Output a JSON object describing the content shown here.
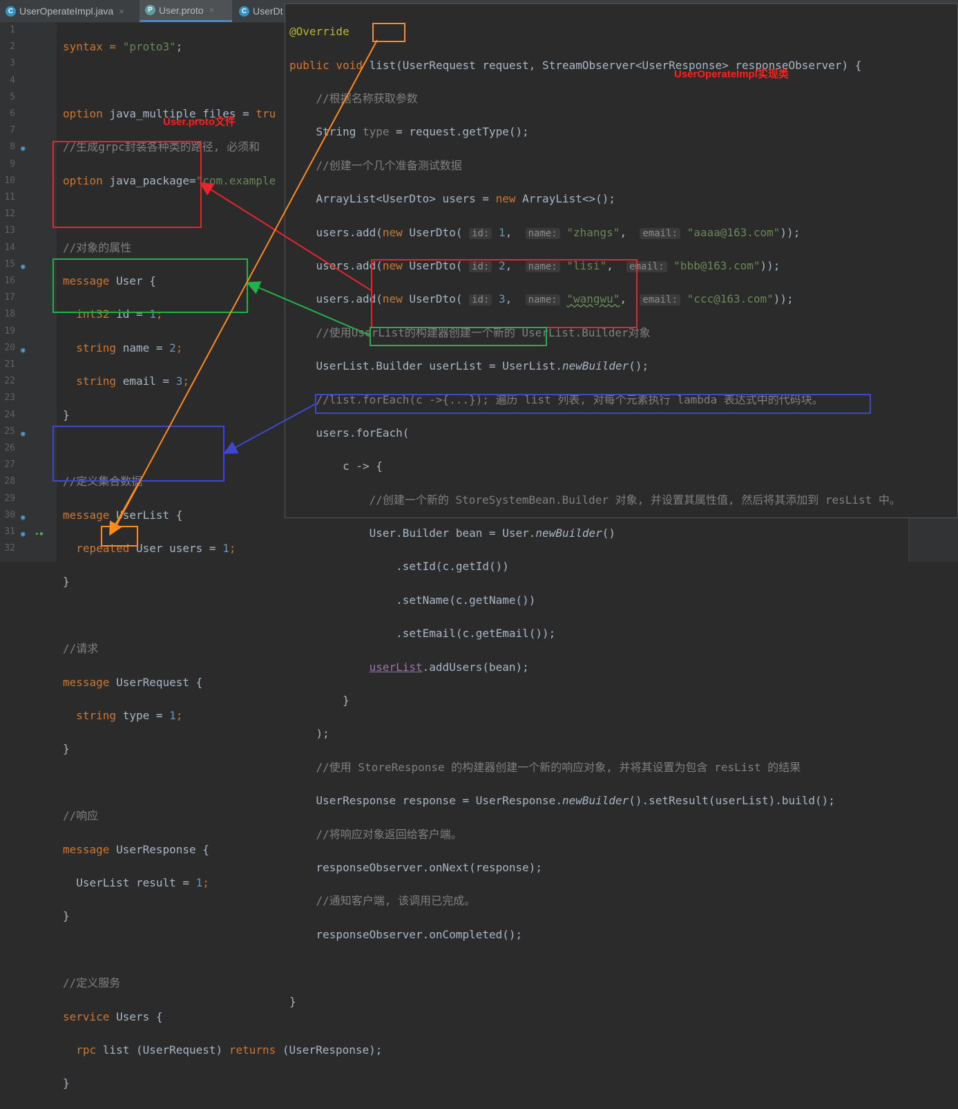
{
  "tabs": [
    {
      "label": "UserOperateImpl.java",
      "icon_letter": "C",
      "icon_color": "#3592c4",
      "active": false
    },
    {
      "label": "User.proto",
      "icon_letter": "P",
      "icon_color": "#5f9ea0",
      "active": true
    },
    {
      "label": "UserDt",
      "icon_letter": "C",
      "icon_color": "#3592c4",
      "active": false
    }
  ],
  "tab_close_glyph": "×",
  "line_numbers": [
    "1",
    "2",
    "3",
    "4",
    "5",
    "6",
    "7",
    "8",
    "9",
    "10",
    "11",
    "12",
    "13",
    "14",
    "15",
    "16",
    "17",
    "18",
    "19",
    "20",
    "21",
    "22",
    "23",
    "24",
    "25",
    "26",
    "27",
    "28",
    "29",
    "30",
    "31",
    "32"
  ],
  "proto": {
    "l1_a": "syntax = ",
    "l1_b": "\"proto3\"",
    "l1_c": ";",
    "l3_a": "option ",
    "l3_b": "java_multiple_files = ",
    "l3_c": "tru",
    "l4": "//生成grpc封装各种类的路径, 必须和",
    "l5_a": "option ",
    "l5_b": "java_package=",
    "l5_c": "\"com.example",
    "l7": "//对象的属性",
    "l8_a": "message ",
    "l8_b": "User {",
    "l9_a": "int32 ",
    "l9_b": "id = ",
    "l9_c": "1",
    "l9_d": ";",
    "l10_a": "string ",
    "l10_b": "name = ",
    "l10_c": "2",
    "l10_d": ";",
    "l11_a": "string ",
    "l11_b": "email = ",
    "l11_c": "3",
    "l11_d": ";",
    "l12": "}",
    "l14": "//定义集合数据",
    "l15_a": "message ",
    "l15_b": "UserList {",
    "l16_a": "repeated ",
    "l16_b": "User users = ",
    "l16_c": "1",
    "l16_d": ";",
    "l17": "}",
    "l19": "//请求",
    "l20_a": "message ",
    "l20_b": "UserRequest {",
    "l21_a": "string ",
    "l21_b": "type = ",
    "l21_c": "1",
    "l21_d": ";",
    "l22": "}",
    "l24": "//响应",
    "l25_a": "message ",
    "l25_b": "UserResponse {",
    "l26_a": "UserList result = ",
    "l26_b": "1",
    "l26_c": ";",
    "l27": "}",
    "l29": "//定义服务",
    "l30_a": "service ",
    "l30_b": "Users {",
    "l31_a": "rpc ",
    "l31_b": "list",
    "l31_c": " (UserRequest) ",
    "l31_d": "returns",
    "l31_e": " (UserResponse);",
    "l32": "}"
  },
  "impl": {
    "r1": "@Override",
    "r2_a": "public ",
    "r2_b": "void ",
    "r2_c": "list",
    "r2_d": "(UserRequest request, StreamObserver<UserResponse> responseObserver) {",
    "r3": "//根据名称获取参数",
    "r4_a": "String ",
    "r4_b": "type",
    "r4_c": " = request.getType();",
    "r5": "//创建一个几个准备测试数据",
    "r6_a": "ArrayList<UserDto> users = ",
    "r6_b": "new ",
    "r6_c": "ArrayList<>();",
    "r7_a": "users.add(",
    "r7_b": "new ",
    "r7_c": "UserDto(",
    "r7_h1": "id:",
    "r7_v1": "1",
    "r7_h2": "name:",
    "r7_v2": "\"zhangs\"",
    "r7_h3": "email:",
    "r7_v3": "\"aaaa@163.com\"",
    "r7_e": "));",
    "r8_a": "users.add(",
    "r8_b": "new ",
    "r8_c": "UserDto(",
    "r8_h1": "id:",
    "r8_v1": "2",
    "r8_h2": "name:",
    "r8_v2": "\"lisi\"",
    "r8_h3": "email:",
    "r8_v3": "\"bbb@163.com\"",
    "r8_e": "));",
    "r9_a": "users.add(",
    "r9_b": "new ",
    "r9_c": "UserDto(",
    "r9_h1": "id:",
    "r9_v1": "3",
    "r9_h2": "name:",
    "r9_v2": "\"wangwu\"",
    "r9_h3": "email:",
    "r9_v3": "\"ccc@163.com\"",
    "r9_e": "));",
    "r10": "//使用UserList的构建器创建一个新的 UserList.Builder对象",
    "r11_a": "UserList.Builder userList = UserList.",
    "r11_b": "newBuilder",
    "r11_c": "();",
    "r12": "//list.forEach(c ->{...}); 遍历 list 列表, 对每个元素执行 lambda 表达式中的代码块。",
    "r13": "users.forEach(",
    "r14": "c -> {",
    "r15": "//创建一个新的 StoreSystemBean.Builder 对象, 并设置其属性值, 然后将其添加到 resList 中。",
    "r16_a": "User.Builder bean = User.",
    "r16_b": "newBuilder",
    "r16_c": "()",
    "r17": ".setId(c.getId())",
    "r18": ".setName(c.getName())",
    "r19": ".setEmail(c.getEmail());",
    "r20_a": "userList",
    "r20_b": ".addUsers(bean);",
    "r21": "}",
    "r22": ");",
    "r23": "//使用 StoreResponse 的构建器创建一个新的响应对象, 并将其设置为包含 resList 的结果",
    "r24_a": "UserResponse response = UserResponse.",
    "r24_b": "newBuilder",
    "r24_c": "().setResult(userList).build();",
    "r25": "//将响应对象返回给客户端。",
    "r26": "responseObserver.onNext(response);",
    "r27": "//通知客户端, 该调用已完成。",
    "r28": "responseObserver.onCompleted();",
    "r30": "}"
  },
  "labels": {
    "proto_file": "User.proto文件",
    "impl_class": "UserOperateImpl实现类"
  },
  "colors": {
    "red": "#e8242c",
    "green": "#22b14c",
    "blue": "#3f48cc",
    "orange": "#ff8c1a"
  }
}
